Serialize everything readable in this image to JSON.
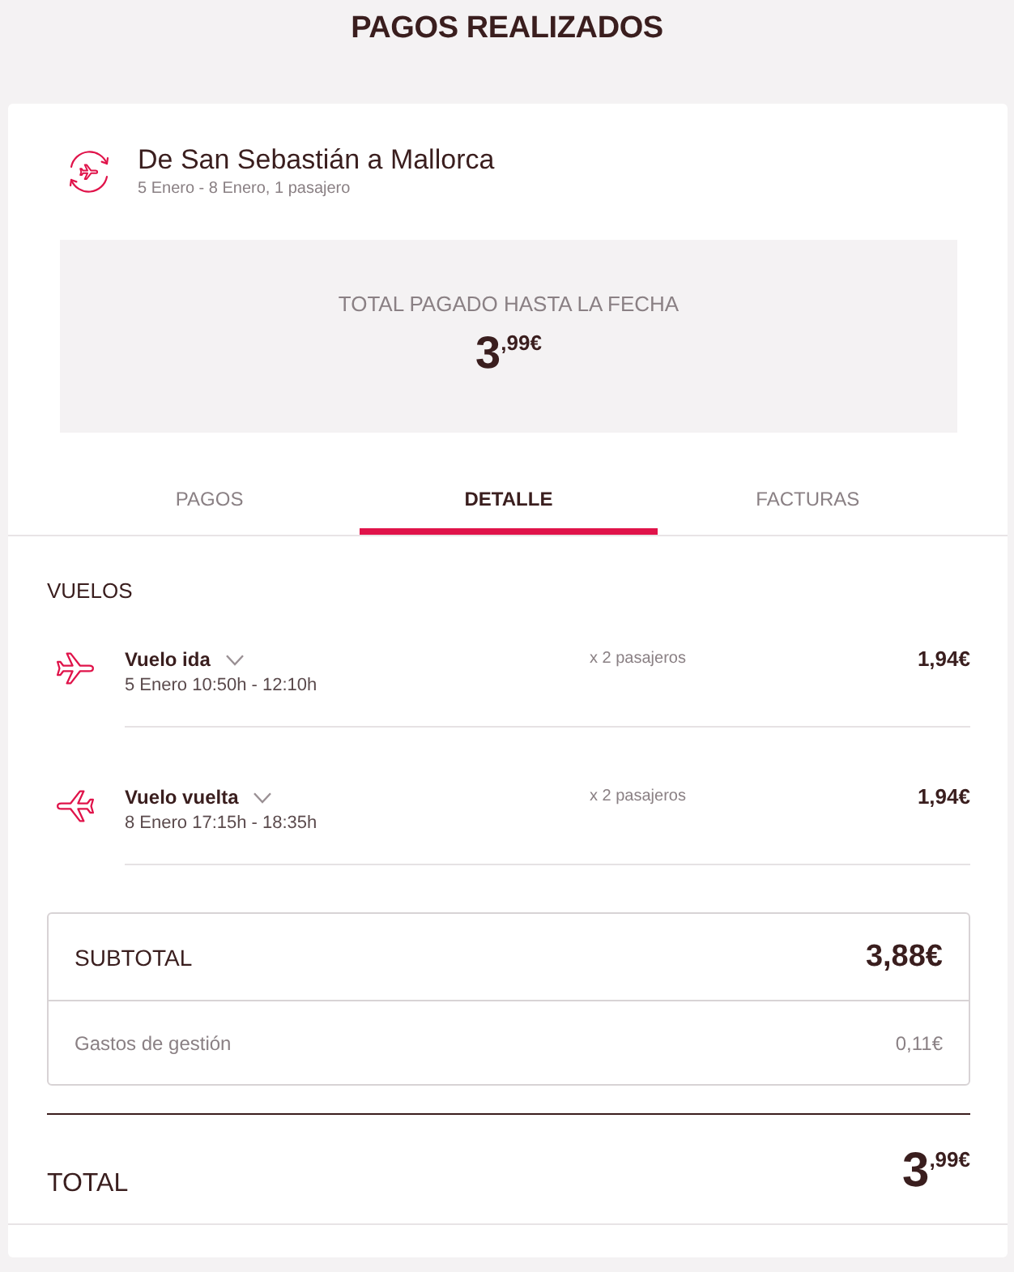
{
  "page": {
    "title": "PAGOS REALIZADOS"
  },
  "trip": {
    "title": "De San Sebastián a Mallorca",
    "subtitle": "5 Enero - 8 Enero, 1 pasajero"
  },
  "paid_summary": {
    "label": "TOTAL PAGADO HASTA LA FECHA",
    "amount": "3$^{,99€}$"
  },
  "tabs": [
    {
      "label": "PAGOS",
      "selected": false
    },
    {
      "label": "DETALLE",
      "selected": true
    },
    {
      "label": "FACTURAS",
      "selected": false
    }
  ],
  "section": {
    "title": "VUELOS",
    "flights": [
      {
        "kind": "outbound",
        "name": "Vuelo ida",
        "expanded": false,
        "schedule": "5 Enero 10:50h - 12:10h",
        "passengers": "x 2 pasajeros",
        "price": "1,94€"
      },
      {
        "kind": "return",
        "name": "Vuelo vuelta",
        "expanded": false,
        "schedule": "8 Enero 17:15h - 18:35h",
        "passengers": "x 2 pasajeros",
        "price": "1,94€"
      }
    ]
  },
  "breakdown": {
    "subtotal": {
      "label": "SUBTOTAL",
      "amount": "3,88€"
    },
    "fee": {
      "label": "Gastos de gestión",
      "amount": "0,11€"
    }
  },
  "total": {
    "label": "TOTAL",
    "amount": "3$^{,99€}$"
  }
}
